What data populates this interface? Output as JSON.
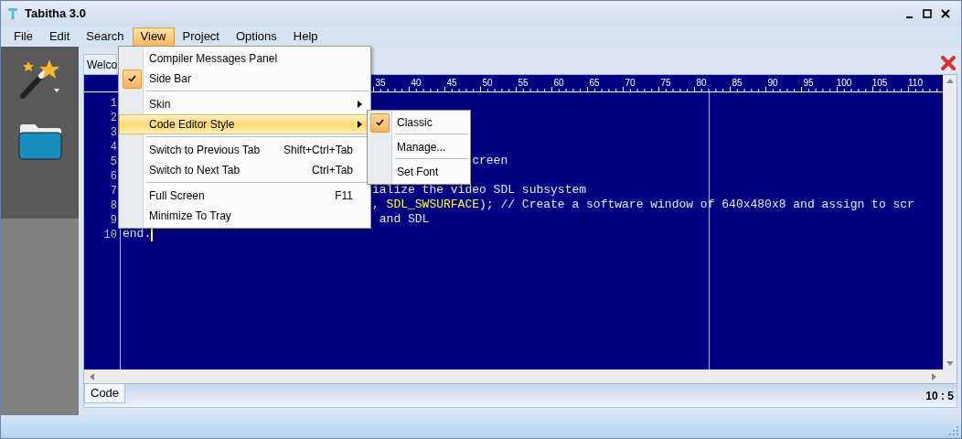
{
  "window": {
    "title": "Tabitha 3.0"
  },
  "menubar": [
    {
      "label": "File",
      "selected": false
    },
    {
      "label": "Edit",
      "selected": false
    },
    {
      "label": "Search",
      "selected": false
    },
    {
      "label": "View",
      "selected": true
    },
    {
      "label": "Project",
      "selected": false
    },
    {
      "label": "Options",
      "selected": false
    },
    {
      "label": "Help",
      "selected": false
    }
  ],
  "view_menu": [
    {
      "kind": "item",
      "label": "Compiler Messages Panel",
      "checked": false,
      "submenu": false,
      "highlighted": false
    },
    {
      "kind": "item",
      "label": "Side Bar",
      "checked": true,
      "submenu": false,
      "highlighted": false
    },
    {
      "kind": "separator"
    },
    {
      "kind": "item",
      "label": "Skin",
      "checked": false,
      "submenu": true,
      "highlighted": false
    },
    {
      "kind": "item",
      "label": "Code Editor Style",
      "checked": false,
      "submenu": true,
      "highlighted": true
    },
    {
      "kind": "separator"
    },
    {
      "kind": "item",
      "label": "Switch to Previous Tab",
      "shortcut": "Shift+Ctrl+Tab",
      "checked": false,
      "submenu": false,
      "highlighted": false
    },
    {
      "kind": "item",
      "label": "Switch to Next Tab",
      "shortcut": "Ctrl+Tab",
      "checked": false,
      "submenu": false,
      "highlighted": false
    },
    {
      "kind": "separator"
    },
    {
      "kind": "item",
      "label": "Full Screen",
      "shortcut": "F11",
      "checked": false,
      "submenu": false,
      "highlighted": false
    },
    {
      "kind": "item",
      "label": "Minimize To Tray",
      "checked": false,
      "submenu": false,
      "highlighted": false
    }
  ],
  "style_submenu": [
    {
      "kind": "item",
      "label": "Classic",
      "checked": true
    },
    {
      "kind": "separator"
    },
    {
      "kind": "item",
      "label": "Manage...",
      "checked": false
    },
    {
      "kind": "separator"
    },
    {
      "kind": "item",
      "label": "Set Font",
      "checked": false
    }
  ],
  "document_tab": {
    "label": "Welco"
  },
  "ruler": [
    "35",
    "40",
    "45",
    "50",
    "55",
    "60",
    "65",
    "70",
    "75",
    "80",
    "85",
    "90",
    "95",
    "100",
    "105",
    "110"
  ],
  "code_lines": [
    {
      "number": "1"
    },
    {
      "number": "2"
    },
    {
      "number": "3"
    },
    {
      "number": "4"
    },
    {
      "number": "5",
      "segments": [
        {
          "kind": "plain",
          "text": "creen"
        }
      ]
    },
    {
      "number": "6"
    },
    {
      "number": "7",
      "segments": [
        {
          "kind": "plain",
          "text": "ialize the video SDL subsystem"
        }
      ]
    },
    {
      "number": "8",
      "segments": [
        {
          "kind": "plain",
          "text": ", "
        },
        {
          "kind": "constant",
          "text": "SDL_SWSURFACE"
        },
        {
          "kind": "plain",
          "text": "); // Create a software window of 640x480x8 and assign to scr"
        }
      ]
    },
    {
      "number": "9",
      "segments": [
        {
          "kind": "plain",
          "text": "and SDL"
        }
      ]
    },
    {
      "number": "10",
      "segments": [
        {
          "kind": "plain",
          "text": "end."
        }
      ],
      "cursor": true
    }
  ],
  "bottom_tabs": [
    {
      "label": "Code",
      "selected": true
    }
  ],
  "cursor_position": "10 : 5"
}
